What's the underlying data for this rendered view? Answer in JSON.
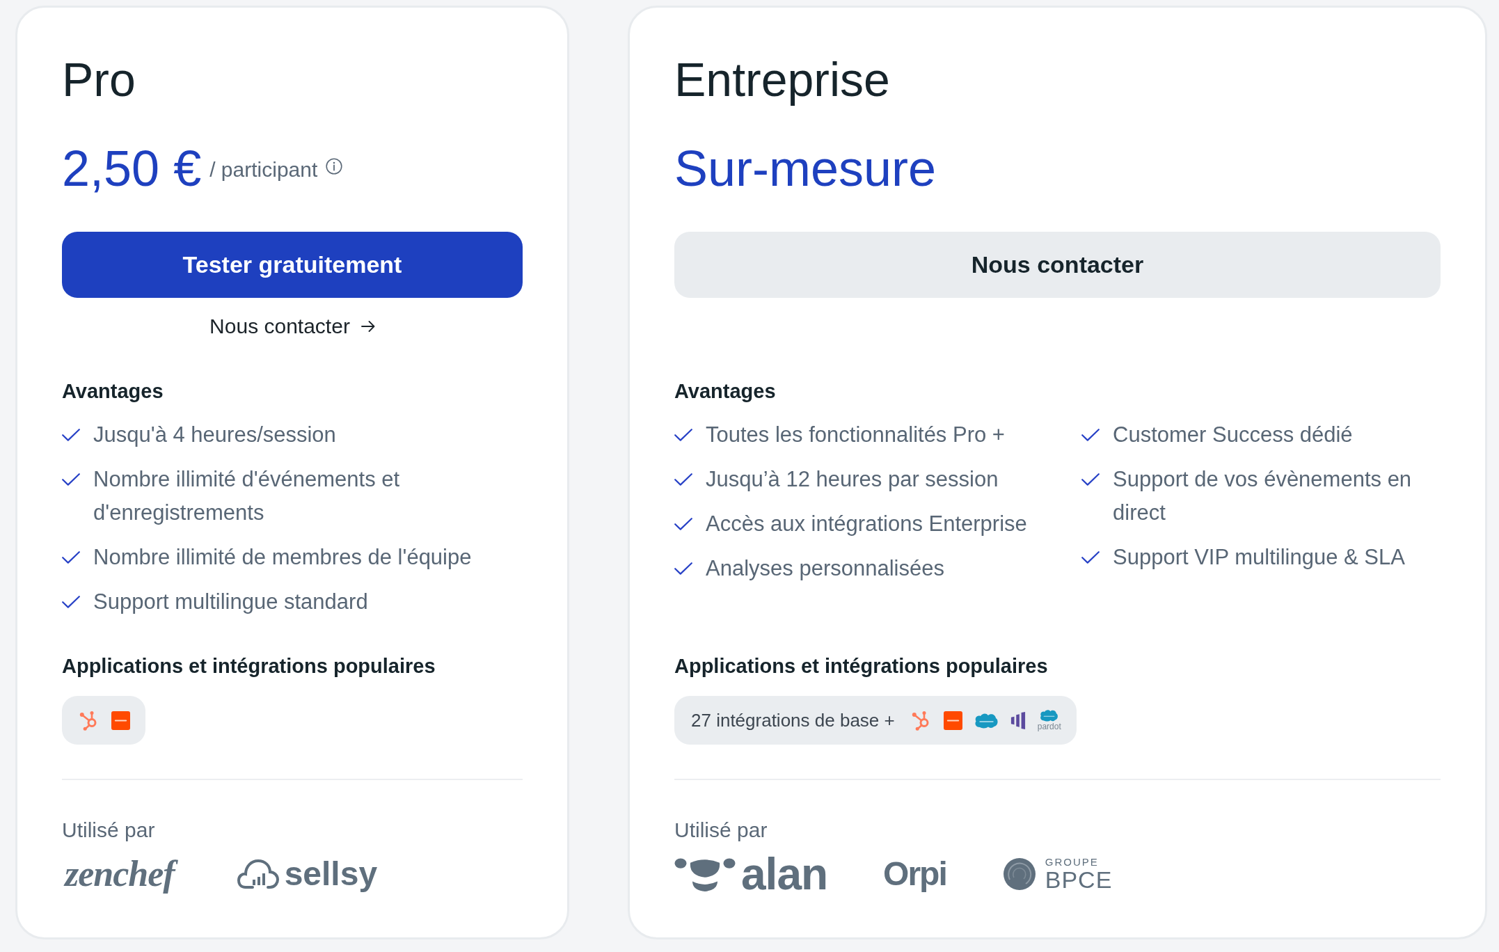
{
  "plans": [
    {
      "name": "Pro",
      "price": "2,50 €",
      "price_unit": "/ participant",
      "button": {
        "label": "Tester gratuitement",
        "kind": "primary"
      },
      "link": {
        "label": "Nous contacter"
      },
      "benefits": {
        "title": "Avantages",
        "columns": [
          [
            "Jusqu'à 4 heures/session",
            "Nombre illimité d'événements et d'enregistrements",
            "Nombre illimité de membres de l'équipe",
            "Support multilingue standard"
          ]
        ]
      },
      "integrations": {
        "title": "Applications et intégrations populaires",
        "items": [
          {
            "kind": "sprocket"
          },
          {
            "kind": "tile"
          }
        ]
      },
      "used_by": {
        "title": "Utilisé par",
        "logos": [
          {
            "kind": "script",
            "name": "zenchef"
          },
          {
            "kind": "cloud",
            "name": "sellsy"
          }
        ]
      }
    },
    {
      "name": "Entreprise",
      "price": "Sur-mesure",
      "button": {
        "label": "Nous contacter",
        "kind": "secondary"
      },
      "benefits": {
        "title": "Avantages",
        "columns": [
          [
            "Toutes les fonctionnalités Pro +",
            "Jusqu’à 12 heures par session",
            "Accès aux intégrations Enterprise",
            "Analyses personnalisées"
          ],
          [
            "Customer Success dédié",
            "Support de vos évènements en direct",
            "Support VIP multilingue & SLA"
          ]
        ]
      },
      "integrations": {
        "title": "Applications et intégrations populaires",
        "summary": "27 intégrations de base +",
        "items": [
          {
            "kind": "sprocket"
          },
          {
            "kind": "tile"
          },
          {
            "kind": "cloud"
          },
          {
            "kind": "bars"
          },
          {
            "kind": "cloud",
            "caption": "pardot"
          }
        ]
      },
      "used_by": {
        "title": "Utilisé par",
        "logos": [
          {
            "kind": "face",
            "name": "alan"
          },
          {
            "kind": "plain",
            "name": "Orpi"
          },
          {
            "kind": "disc",
            "tagline": "GROUPE",
            "name": "BPCE"
          }
        ]
      }
    }
  ]
}
